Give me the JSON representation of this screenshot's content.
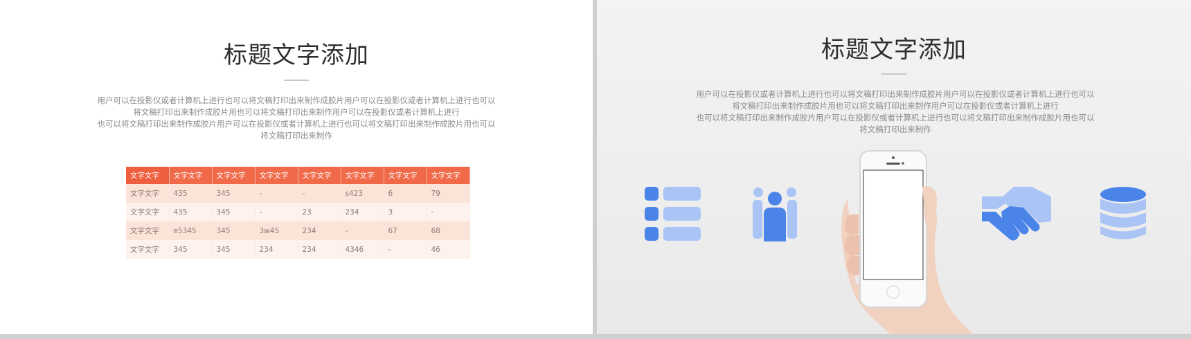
{
  "left_slide": {
    "title": "标题文字添加",
    "paragraph": [
      "用户可以在投影仪或者计算机上进行也可以将文稿打印出来制作成胶片用户可以在投影仪或者计算机上进行也可以",
      "将文稿打印出来制作成胶片用也可以将文稿打印出来制作用户可以在投影仪或者计算机上进行",
      "也可以将文稿打印出来制作成胶片用户可以在投影仪或者计算机上进行也可以将文稿打印出来制作成胶片用也可以",
      "将文稿打印出来制作"
    ],
    "table": {
      "headers": [
        "文字文字",
        "文字文字",
        "文字文字",
        "文字文字",
        "文字文字",
        "文字文字",
        "文字文字",
        "文字文字"
      ],
      "rows": [
        [
          "文字文字",
          "435",
          "345",
          "-",
          "-",
          "s423",
          "6",
          "79"
        ],
        [
          "文字文字",
          "435",
          "345",
          "-",
          "23",
          "234",
          "3",
          "-"
        ],
        [
          "文字文字",
          "e5345",
          "345",
          "3w45",
          "234",
          "-",
          "67",
          "68"
        ],
        [
          "文字文字",
          "345",
          "345",
          "234",
          "234",
          "4346",
          "-",
          "46"
        ]
      ],
      "colors": {
        "header": "#f06a4a",
        "row_odd": "#fbe3d8",
        "row_even": "#fdf2ed"
      }
    }
  },
  "right_slide": {
    "title": "标题文字添加",
    "paragraph": [
      "用户可以在投影仪或者计算机上进行也可以将文稿打印出来制作成胶片用户可以在投影仪或者计算机上进行也可以",
      "将文稿打印出来制作成胶片用也可以将文稿打印出来制作用户可以在投影仪或者计算机上进行",
      "也可以将文稿打印出来制作成胶片用户可以在投影仪或者计算机上进行也可以将文稿打印出来制作成胶片用也可以",
      "将文稿打印出来制作"
    ],
    "icons": [
      "list-icon",
      "team-icon",
      "phone-in-hand-image",
      "handshake-icon",
      "database-icon"
    ],
    "colors": {
      "icon_dark": "#4a84e8",
      "icon_light": "#a9c4f5"
    }
  }
}
